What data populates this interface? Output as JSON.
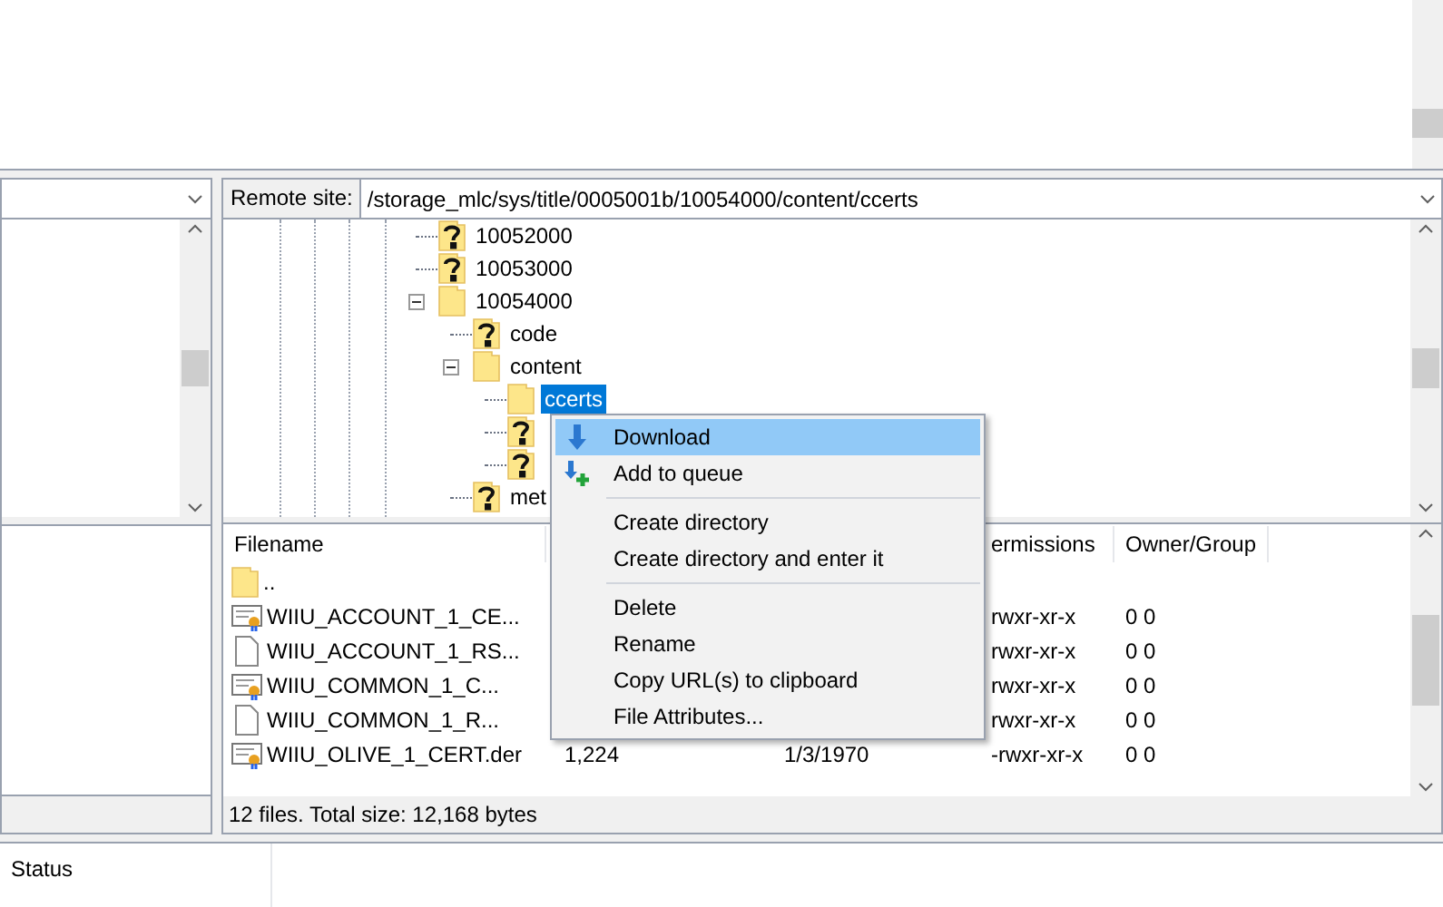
{
  "remote_site": {
    "label": "Remote site:",
    "path": "/storage_mlc/sys/title/0005001b/10054000/content/ccerts"
  },
  "tree": [
    {
      "name": "10052000",
      "kind": "unknown",
      "selected": false
    },
    {
      "name": "10053000",
      "kind": "unknown",
      "selected": false
    },
    {
      "name": "10054000",
      "kind": "folder",
      "expanded": true,
      "selected": false,
      "children": [
        {
          "name": "code",
          "kind": "unknown",
          "selected": false
        },
        {
          "name": "content",
          "kind": "folder",
          "expanded": true,
          "selected": false,
          "children": [
            {
              "name": "ccerts",
              "kind": "folder",
              "selected": true
            },
            {
              "kind": "unknown",
              "selected": false
            },
            {
              "kind": "unknown",
              "selected": false
            }
          ]
        },
        {
          "name": "met",
          "kind": "unknown",
          "selected": false
        }
      ]
    }
  ],
  "file_list": {
    "columns": [
      "Filename",
      "ermissions",
      "Owner/Group"
    ],
    "rows": [
      {
        "kind": "folder",
        "name": ".."
      },
      {
        "kind": "cert",
        "name": "WIIU_ACCOUNT_1_CE...",
        "permissions": "rwxr-xr-x",
        "owner": "0 0"
      },
      {
        "kind": "file",
        "name": "WIIU_ACCOUNT_1_RS...",
        "permissions": "rwxr-xr-x",
        "owner": "0 0"
      },
      {
        "kind": "cert",
        "name": "WIIU_COMMON_1_C...",
        "permissions": "rwxr-xr-x",
        "owner": "0 0"
      },
      {
        "kind": "file",
        "name": "WIIU_COMMON_1_R...",
        "permissions": "rwxr-xr-x",
        "owner": "0 0"
      },
      {
        "kind": "cert",
        "name": "WIIU_OLIVE_1_CERT.der",
        "size": "1,224",
        "date": "1/3/1970",
        "permissions": "-rwxr-xr-x",
        "owner": "0 0"
      }
    ],
    "summary": "12 files. Total size: 12,168 bytes"
  },
  "context_menu": [
    {
      "kind": "download",
      "label": "Download",
      "selected": true
    },
    {
      "kind": "queue",
      "label": "Add to queue",
      "selected": false
    },
    {
      "kind": "separator"
    },
    {
      "kind": "item",
      "label": "Create directory",
      "selected": false
    },
    {
      "kind": "item",
      "label": "Create directory and enter it",
      "selected": false
    },
    {
      "kind": "separator"
    },
    {
      "kind": "item",
      "label": "Delete",
      "selected": false
    },
    {
      "kind": "item",
      "label": "Rename",
      "selected": false
    },
    {
      "kind": "item",
      "label": "Copy URL(s) to clipboard",
      "selected": false
    },
    {
      "kind": "item",
      "label": "File Attributes...",
      "selected": false
    }
  ],
  "queue_tabs": [
    {
      "label": "Status"
    }
  ]
}
